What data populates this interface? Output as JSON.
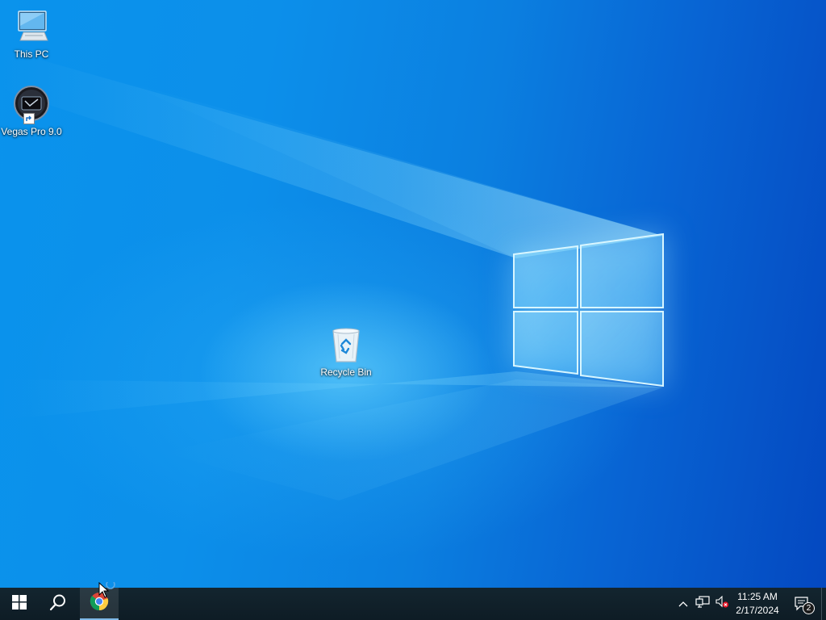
{
  "desktop": {
    "icons": [
      {
        "label": "This PC",
        "icon": "this-pc-icon"
      },
      {
        "label": "Vegas Pro 9.0",
        "icon": "vegas-pro-icon"
      },
      {
        "label": "Recycle Bin",
        "icon": "recycle-bin-icon"
      }
    ]
  },
  "taskbar": {
    "start_icon": "windows-start-icon",
    "search_icon": "search-icon",
    "pinned": [
      {
        "name": "Google Chrome",
        "icon": "chrome-icon",
        "active": true
      }
    ],
    "tray": {
      "icons": [
        "chevron-up-icon",
        "network-icon",
        "volume-muted-icon"
      ],
      "time": "11:25 AM",
      "date": "2/17/2024",
      "notification_count": "2"
    }
  },
  "colors": {
    "taskbar": "#10202b",
    "wallpaper_light": "#0a93ec",
    "wallpaper_dark": "#0448c0"
  }
}
